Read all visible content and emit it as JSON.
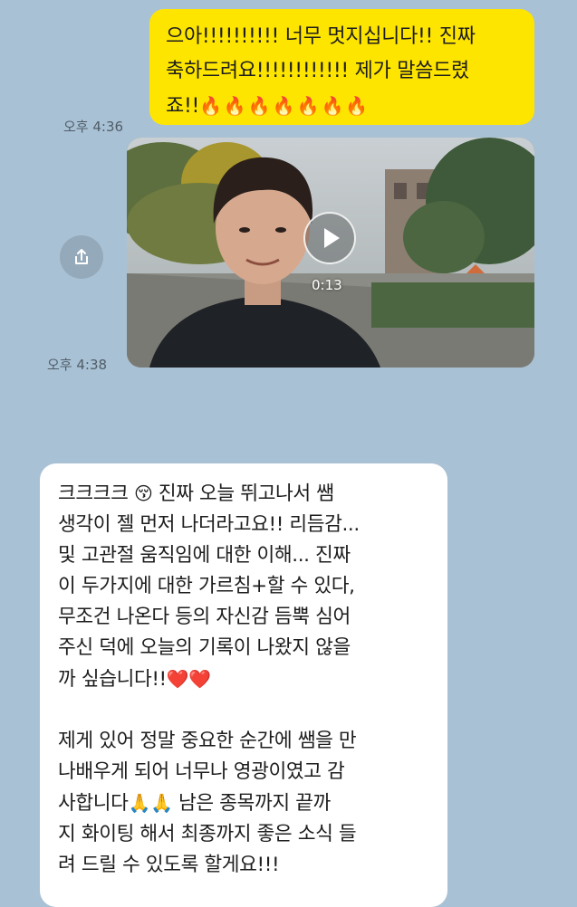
{
  "messages": {
    "outgoing_text": {
      "lines": [
        "으아!!!!!!!!!! 너무 멋지십니다!! 진짜",
        "축하드려요!!!!!!!!!!!! 제가 말씀드렸",
        "죠!!"
      ],
      "fire_emojis": "🔥🔥🔥🔥🔥🔥🔥",
      "timestamp": "오후 4:36"
    },
    "video": {
      "duration": "0:13",
      "timestamp": "오후 4:38"
    },
    "incoming_text": {
      "para1": [
        "크크크크",
        "진짜 오늘 뛰고나서 쌤",
        "생각이 젤 먼저 나더라고요!! 리듬감...",
        "및 고관절 움직임에 대한 이해... 진짜",
        "이 두가지에 대한 가르침+할 수 있다,",
        "무조건 나온다 등의 자신감 듬뿍 심어",
        "주신 덕에 오늘의 기록이 나왔지 않을",
        "까 싶습니다!!"
      ],
      "para2": [
        "제게 있어 정말 중요한 순간에 쌤을 만",
        "나배우게 되어 너무나 영광이였고 감",
        "사합니다",
        "남은 종목까지 끝까",
        "지 화이팅 해서 최종까지 좋은 소식 들",
        "려 드릴 수 있도록 할게요!!!"
      ],
      "emojis": {
        "blush": "😚",
        "hearts": "❤️❤️",
        "pray": "🙏🙏"
      }
    }
  },
  "colors": {
    "background": "#a9c1d4",
    "outgoing_bubble": "#fee500",
    "incoming_bubble": "#ffffff"
  },
  "icons": {
    "share": "share-icon",
    "play": "play-icon"
  }
}
